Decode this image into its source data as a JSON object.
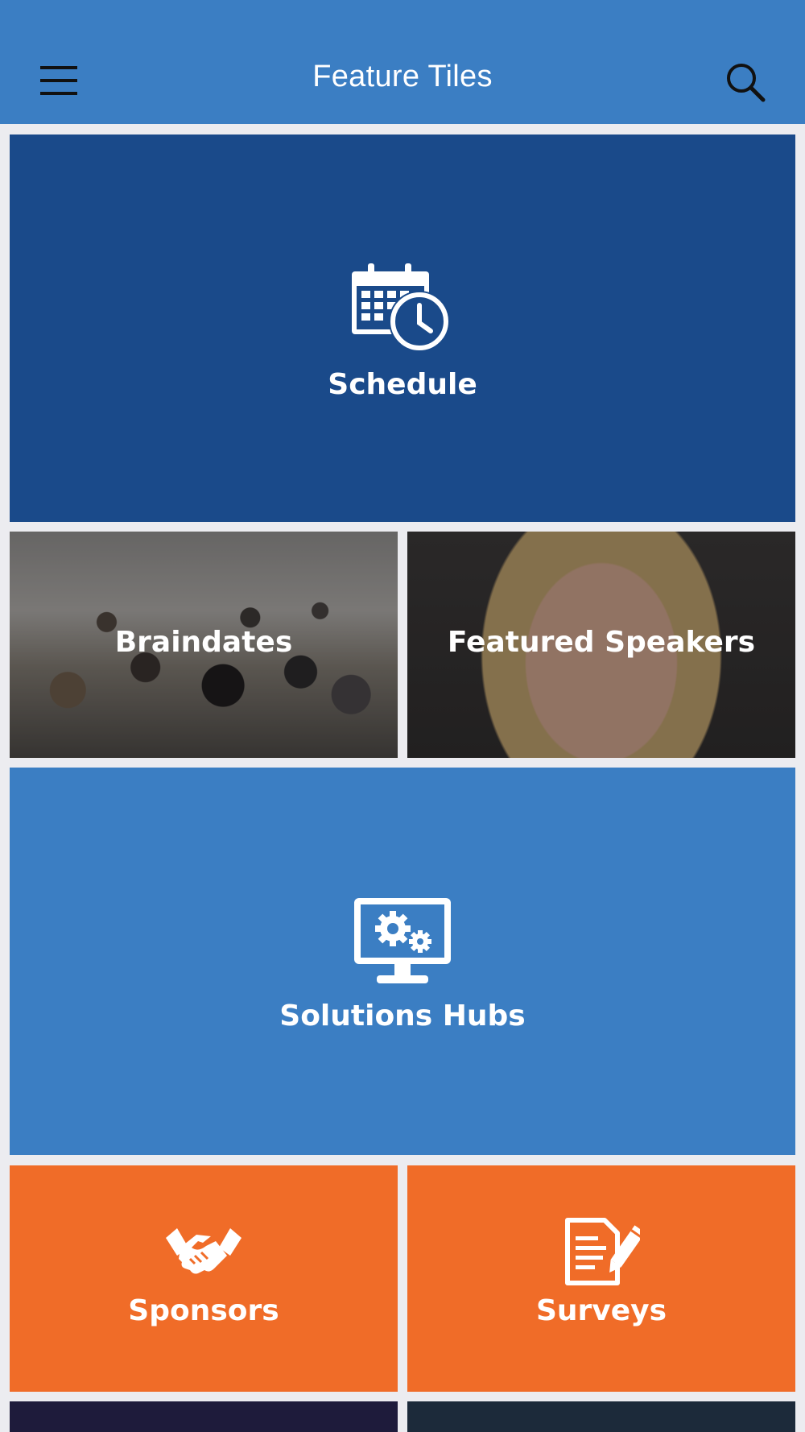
{
  "header": {
    "title": "Feature Tiles",
    "menu_icon": "hamburger-menu-icon",
    "search_icon": "search-icon"
  },
  "tiles": [
    {
      "label": "Schedule",
      "icon": "calendar-clock-icon",
      "color": "#1a4a8a"
    },
    {
      "label": "Braindates",
      "image": "crowd-photo"
    },
    {
      "label": "Featured Speakers",
      "image": "speaker-portrait-photo"
    },
    {
      "label": "Solutions Hubs",
      "icon": "monitor-gears-icon",
      "color": "#3b7ec3"
    },
    {
      "label": "Sponsors",
      "icon": "handshake-icon",
      "color": "#f06c28"
    },
    {
      "label": "Surveys",
      "icon": "document-pencil-icon",
      "color": "#f06c28"
    }
  ],
  "colors": {
    "header": "#3b7ec3",
    "background": "#ececf0"
  }
}
